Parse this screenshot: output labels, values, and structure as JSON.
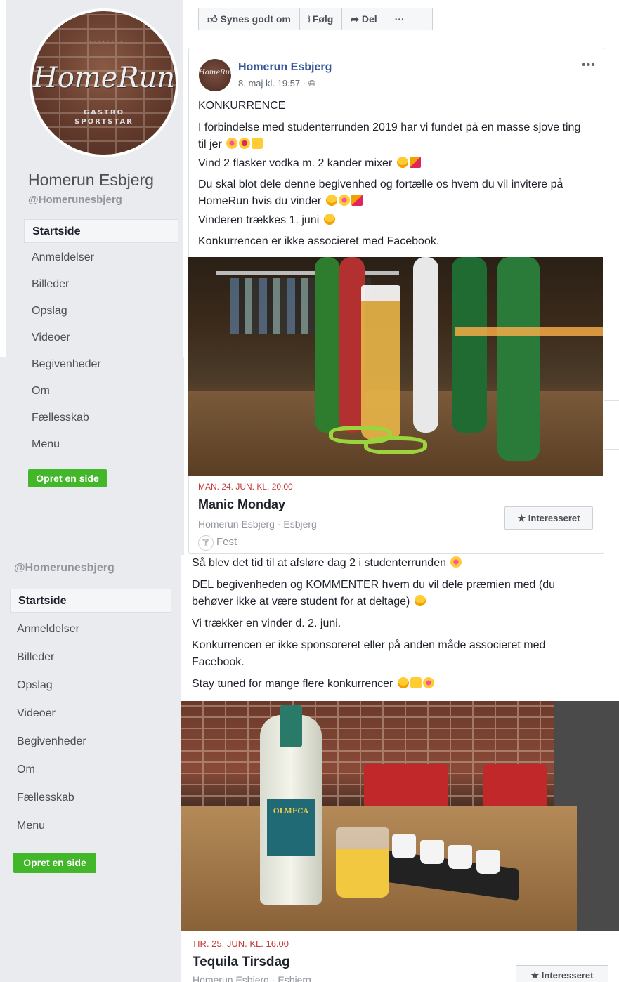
{
  "page": {
    "name": "Homerun Esbjerg",
    "handle": "@Homerunesbjerg",
    "avatar_text": "HomeRun",
    "avatar_sub": "GASTRO\nSPORTSTAR"
  },
  "nav": {
    "items": [
      "Startside",
      "Anmeldelser",
      "Billeder",
      "Opslag",
      "Videoer",
      "Begivenheder",
      "Om",
      "Fællesskab",
      "Menu"
    ],
    "create_page_label": "Opret en side"
  },
  "action_bar": {
    "like_label": "Synes godt om",
    "follow_label": "Følg",
    "share_label": "Del",
    "more_label": "···"
  },
  "post1": {
    "author": "Homerun Esbjerg",
    "time": "8. maj kl. 19.57 · ",
    "more_label": "•••",
    "lines": [
      "KONKURRENCE",
      "I forbindelse med studenterrunden 2019 har vi fundet på en masse sjove ting til jer",
      "Vind 2 flasker vodka m. 2 kander mixer",
      "Du skal blot dele denne begivenhed og fortælle os hvem du vil invitere på HomeRun hvis du vinder",
      "Vinderen trækkes 1. juni",
      "Konkurrencen er ikke associeret med Facebook."
    ],
    "event": {
      "date": "MAN. 24. JUN. KL. 20.00",
      "title": "Manic Monday",
      "location": "Homerun Esbjerg · Esbjerg",
      "category": "Fest",
      "interested_label": "★ Interesseret"
    }
  },
  "post2": {
    "lines": [
      "Så blev det tid til at afsløre dag 2 i studenterrunden",
      "DEL begivenheden og KOMMENTER hvem du vil dele præmien med (du behøver ikke at være student for at deltage)",
      "Vi trækker en vinder d. 2. juni.",
      "Konkurrencen er ikke sponsoreret eller på anden måde associeret med Facebook.",
      "Stay tuned for mange flere konkurrencer"
    ],
    "bottle_label": "OLMECA",
    "event": {
      "date": "TIR. 25. JUN. KL. 16.00",
      "title": "Tequila Tirsdag",
      "location": "Homerun Esbjerg · Esbjerg",
      "interested_label": "★ Interesseret"
    }
  },
  "colors": {
    "link": "#365899",
    "green": "#42b72a",
    "event_date": "#c33b37",
    "sidebar_bg": "#e9ebee"
  }
}
